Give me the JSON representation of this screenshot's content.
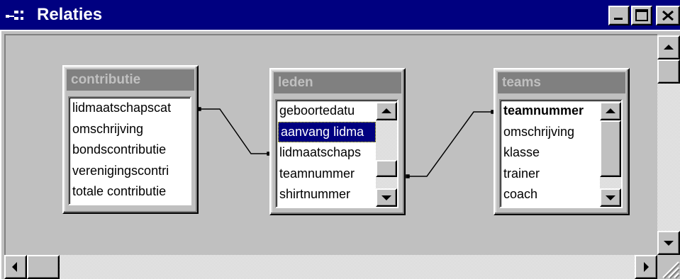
{
  "window": {
    "title": "Relaties"
  },
  "tables": [
    {
      "name": "contributie",
      "fields": [
        "lidmaatschapscat",
        "omschrijving",
        "bondscontributie",
        "verenigingscontri",
        "totale contributie"
      ]
    },
    {
      "name": "leden",
      "fields": [
        "geboortedatu",
        "aanvang lidma",
        "lidmaatschaps",
        "teamnummer",
        "shirtnummer"
      ],
      "selected": "aanvang lidma"
    },
    {
      "name": "teams",
      "fields": [
        "teamnummer",
        "omschrijving",
        "klasse",
        "trainer",
        "coach"
      ],
      "primary_key": "teamnummer"
    }
  ],
  "icons": {
    "app": "relationships-icon",
    "minimize": "minimize-icon",
    "maximize": "maximize-icon",
    "close": "close-icon"
  },
  "colors": {
    "titlebar": "#000080",
    "selection": "#000080",
    "table_header": "#808080"
  }
}
